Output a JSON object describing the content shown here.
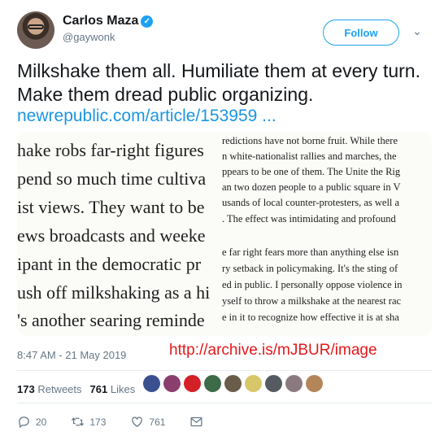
{
  "author": {
    "name": "Carlos Maza",
    "handle": "@gaywonk"
  },
  "follow_label": "Follow",
  "tweet": {
    "text": "Milkshake them all. Humiliate them at every turn. Make them dread public organizing.",
    "link": "newrepublic.com/article/153959 ..."
  },
  "media": {
    "left_lines": [
      "hake robs far-right figures",
      "pend so much time cultiva",
      "ist views. They want to be",
      "ews broadcasts and weeke",
      "ipant in the democratic pr",
      "ush off milkshaking as a hi",
      "'s another searing reminde"
    ],
    "right_lines": [
      "redictions have not borne fruit. While there",
      "n white-nationalist rallies and marches, the",
      "ppears to be one of them. The Unite the Rig",
      "an two dozen people to a public square in V",
      "usands of local counter-protesters, as well a",
      ". The effect was intimidating and profound",
      "",
      "e far right fears more than anything else isn",
      "ry setback in policymaking. It's the sting of",
      "ed in public. I personally oppose violence in",
      "yself to throw a milkshake at the nearest rac",
      "e in it to recognize how effective it is at sha"
    ]
  },
  "timestamp": "8:47 AM - 21 May 2019",
  "archive_note": "http://archive.is/mJBUR/image",
  "stats": {
    "retweets_count": "173",
    "retweets_label": "Retweets",
    "likes_count": "761",
    "likes_label": "Likes"
  },
  "likers": [
    "avatar-1",
    "avatar-2",
    "avatar-3",
    "avatar-4",
    "avatar-5",
    "avatar-6",
    "avatar-7",
    "avatar-8",
    "avatar-9"
  ],
  "actions": {
    "replies": "20",
    "retweets": "173",
    "likes": "761"
  },
  "colors": {
    "accent": "#1da1f2",
    "link": "#1b95e0",
    "archive_red": "#e4181a",
    "muted": "#657786"
  }
}
